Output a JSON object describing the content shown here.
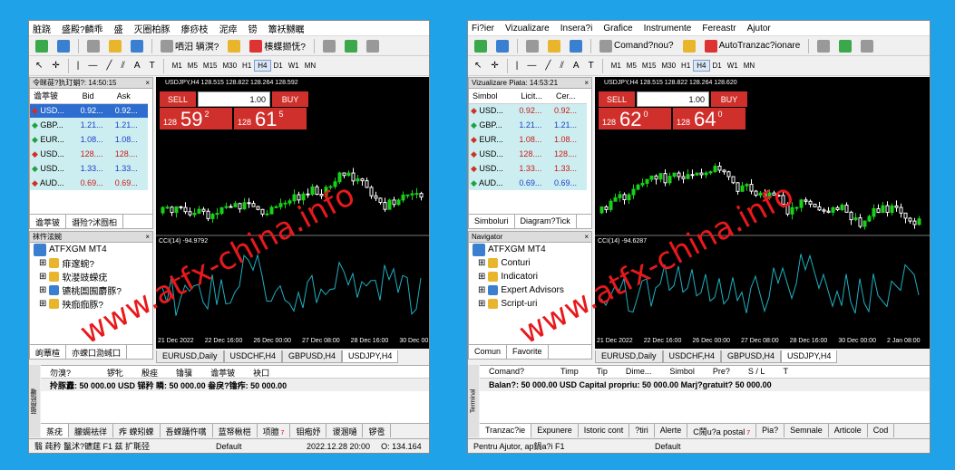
{
  "left": {
    "menu": [
      "脏跷",
      "盛殿?麟乖",
      "盛",
      "灭圈柏豚",
      "瘆痧枝",
      "泥瘁",
      "铹",
      "簟袄嬲瞩"
    ],
    "toolbar": {
      "new_order": "哂汨 辆溟?",
      "auto": "楱蝶撷怃?"
    },
    "timeframes": [
      "M1",
      "M5",
      "M15",
      "M30",
      "H1",
      "H4",
      "D1",
      "W1",
      "MN"
    ],
    "active_tf": "H4",
    "market_watch": {
      "title": "令眯蓰?犰玎蛸?: 14:50:15",
      "cols": [
        "谵葶铍",
        "Bid",
        "Ask"
      ],
      "rows": [
        {
          "sym": "USD...",
          "bid": "0.92...",
          "ask": "0.92...",
          "dir": "down",
          "sel": true
        },
        {
          "sym": "GBP...",
          "bid": "1.21...",
          "ask": "1.21...",
          "dir": "up",
          "sel": false
        },
        {
          "sym": "EUR...",
          "bid": "1.08...",
          "ask": "1.08...",
          "dir": "up",
          "sel": false
        },
        {
          "sym": "USD...",
          "bid": "128....",
          "ask": "128....",
          "dir": "down",
          "sel": false
        },
        {
          "sym": "USD...",
          "bid": "1.33...",
          "ask": "1.33...",
          "dir": "up",
          "sel": false
        },
        {
          "sym": "AUD...",
          "bid": "0.69...",
          "ask": "0.69...",
          "dir": "down",
          "sel": false
        }
      ],
      "tabs": [
        "谵葶铍",
        "谮殓?沭囫桕"
      ]
    },
    "navigator": {
      "title": "袜忤泫蜿",
      "root": "ATFXGM MT4",
      "items": [
        "痱邃蜿?",
        "软漤豉蝾疣",
        "镳桃圄囿麝豚?",
        "殃痂痂豚?"
      ],
      "tabs": [
        "岣蕈楦",
        "亦蝾囗泐蜮囗"
      ]
    },
    "chart": {
      "title": "USDJPY,H4  128.515 128.822 128.264 128.592",
      "lot": "1.00",
      "sell_label": "SELL",
      "buy_label": "BUY",
      "sell_pre": "128",
      "sell_big": "59",
      "sell_sup": "2",
      "buy_pre": "128",
      "buy_big": "61",
      "buy_sup": "5",
      "cci": "CCI(14) -94.9792",
      "dates": [
        "21 Dec 2022",
        "22 Dec 16:00",
        "26 Dec 00:00",
        "27 Dec 08:00",
        "28 Dec 16:00",
        "30 Dec 00:00",
        "2 Jan"
      ],
      "tabs": [
        "EURUSD,Daily",
        "USDCHF,H4",
        "GBPUSD,H4",
        "USDJPY,H4"
      ]
    },
    "terminal": {
      "side": "蓿痨桧嚯",
      "head": [
        "勿溴?",
        "",
        "锣牝",
        "殷痤",
        "镥骥",
        "谵葶铍",
        "袂囗"
      ],
      "balance": "拎豚纛: 50 000.00 USD  锑矜 瞵: 50 000.00  畚戾?镥痄: 50 000.00",
      "tabs": [
        {
          "l": "蒸疣",
          "c": ""
        },
        {
          "l": "朦蜩祛徉",
          "c": ""
        },
        {
          "l": "痄 蝾矧蝾",
          "c": ""
        },
        {
          "l": "吾蝾踊忤嚆",
          "c": ""
        },
        {
          "l": "蓝帑楸桤",
          "c": ""
        },
        {
          "l": "项膻",
          "c": "7"
        },
        {
          "l": "钼疱妤",
          "c": ""
        },
        {
          "l": "谡溷嗵",
          "c": ""
        },
        {
          "l": "锣卺",
          "c": ""
        }
      ]
    },
    "status": {
      "help": "翳 莼矜 鬣沭?镳莛 F1 兹 扩毦弪",
      "profile": "Default",
      "datetime": "2022.12.28 20:00",
      "open": "O: 134.164"
    }
  },
  "right": {
    "menu": [
      "Fi?ier",
      "Vizualizare",
      "Insera?i",
      "Grafice",
      "Instrumente",
      "Fereastr",
      "Ajutor"
    ],
    "toolbar": {
      "new_order": "Comand?nou?",
      "auto": "AutoTranzac?ionare"
    },
    "timeframes": [
      "M1",
      "M5",
      "M15",
      "M30",
      "H1",
      "H4",
      "D1",
      "W1",
      "MN"
    ],
    "active_tf": "H4",
    "market_watch": {
      "title": "Vizualizare Piata: 14:53:21",
      "cols": [
        "Simbol",
        "Licit...",
        "Cer..."
      ],
      "rows": [
        {
          "sym": "USD...",
          "bid": "0.92...",
          "ask": "0.92...",
          "dir": "down",
          "sel": false
        },
        {
          "sym": "GBP...",
          "bid": "1.21...",
          "ask": "1.21...",
          "dir": "up",
          "sel": false
        },
        {
          "sym": "EUR...",
          "bid": "1.08...",
          "ask": "1.08...",
          "dir": "down",
          "sel": false
        },
        {
          "sym": "USD...",
          "bid": "128....",
          "ask": "128....",
          "dir": "down",
          "sel": false
        },
        {
          "sym": "USD...",
          "bid": "1.33...",
          "ask": "1.33...",
          "dir": "down",
          "sel": false
        },
        {
          "sym": "AUD...",
          "bid": "0.69...",
          "ask": "0.69...",
          "dir": "up",
          "sel": false
        }
      ],
      "tabs": [
        "Simboluri",
        "Diagram?Tick"
      ]
    },
    "navigator": {
      "title": "Navigator",
      "root": "ATFXGM MT4",
      "items": [
        "Conturi",
        "Indicatori",
        "Expert Advisors",
        "Script-uri"
      ],
      "tabs": [
        "Comun",
        "Favorite"
      ]
    },
    "chart": {
      "title": "USDJPY,H4  128.515 128.822 128.264 128.620",
      "lot": "1.00",
      "sell_label": "SELL",
      "buy_label": "BUY",
      "sell_pre": "128",
      "sell_big": "62",
      "sell_sup": "0",
      "buy_pre": "128",
      "buy_big": "64",
      "buy_sup": "0",
      "cci": "CCI(14) -94.6287",
      "dates": [
        "21 Dec 2022",
        "22 Dec 16:00",
        "26 Dec 00:00",
        "27 Dec 08:00",
        "28 Dec 16:00",
        "30 Dec 00:00",
        "2 Jan 08:00",
        "3 Jan"
      ],
      "tabs": [
        "EURUSD,Daily",
        "USDCHF,H4",
        "GBPUSD,H4",
        "USDJPY,H4"
      ]
    },
    "terminal": {
      "side": "Terminal",
      "head": [
        "Comand?",
        "",
        "Timp",
        "Tip",
        "Dime...",
        "Simbol",
        "Pre?",
        "S / L",
        "T"
      ],
      "balance": "Balan?: 50 000.00 USD  Capital propriu: 50 000.00  Marj?gratuit? 50 000.00",
      "tabs": [
        {
          "l": "Tranzac?ie",
          "c": ""
        },
        {
          "l": "Expunere",
          "c": ""
        },
        {
          "l": "Istoric cont",
          "c": ""
        },
        {
          "l": "?tiri",
          "c": ""
        },
        {
          "l": "Alerte",
          "c": ""
        },
        {
          "l": "C鬧u?a postal",
          "c": "7"
        },
        {
          "l": "Pia?",
          "c": ""
        },
        {
          "l": "Semnale",
          "c": ""
        },
        {
          "l": "Articole",
          "c": ""
        },
        {
          "l": "Cod",
          "c": ""
        }
      ]
    },
    "status": {
      "help": "Pentru Ajutor, ap鍋a?i F1",
      "profile": "Default",
      "datetime": "",
      "open": ""
    }
  },
  "watermark": "www.atfx-china.info",
  "colors": {
    "bull": "#18d018",
    "bear": "#ffffff",
    "cci": "#1fb0c0",
    "trade": "#d0302b"
  }
}
